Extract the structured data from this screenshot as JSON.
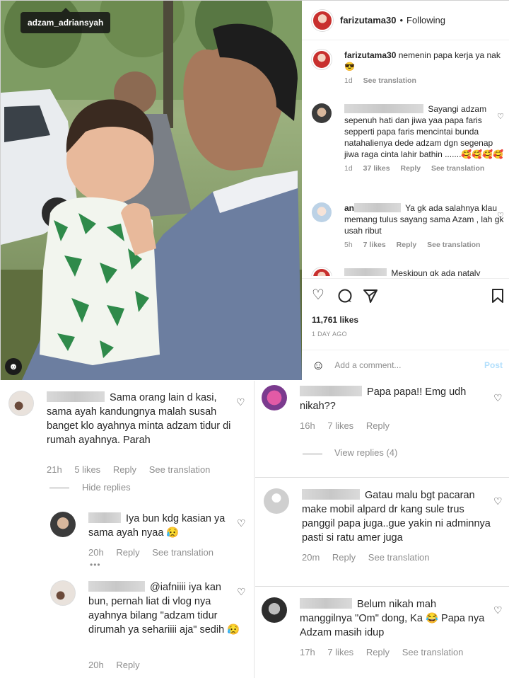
{
  "post": {
    "tag_username": "adzam_adriansyah",
    "header": {
      "username": "farizutama30",
      "separator": "•",
      "follow_status": "Following"
    },
    "caption": {
      "username": "farizutama30",
      "text": "nemenin papa kerja ya nak 😎",
      "time": "1d",
      "see_translation": "See translation"
    },
    "comments": [
      {
        "text": "Sayangi adzam sepenuh hati dan jiwa yaa papa faris sepperti papa faris mencintai bunda natahalienya dede adzam dgn segenap jiwa raga cinta lahir bathin .......🥰🥰🥰🥰",
        "time": "1d",
        "likes": "37 likes",
        "reply": "Reply",
        "see_translation": "See translation"
      },
      {
        "prefix": "an",
        "text": "Ya gk ada salahnya klau memang tulus sayang sama Azam , lah gk usah ribut",
        "time": "5h",
        "likes": "7 likes",
        "reply": "Reply",
        "see_translation": "See translation"
      },
      {
        "text": "Meskipun gk ada nataly"
      }
    ],
    "likes": "11,761 likes",
    "date": "1 DAY AGO",
    "add_comment_placeholder": "Add a comment...",
    "post_button": "Post",
    "icons": {
      "like": "heart-icon",
      "comment": "comment-icon",
      "share": "share-icon",
      "save": "bookmark-icon",
      "emoji": "emoji-icon",
      "user_tag": "user-tag-icon"
    }
  },
  "left_panel": {
    "comment1": {
      "text": "Sama orang lain d kasi, sama ayah kandungnya malah susah banget klo ayahnya minta adzam tidur di rumah ayahnya. Parah",
      "time": "21h",
      "likes": "5 likes",
      "reply": "Reply",
      "see_translation": "See translation"
    },
    "hide_replies": "Hide replies",
    "reply1": {
      "text": "Iya bun kdg kasian ya sama ayah nyaa 😥",
      "time": "20h",
      "reply": "Reply",
      "see_translation": "See translation"
    },
    "more_dots": "•••",
    "reply2": {
      "mention": "@iafniiii",
      "text": "iya kan bun, pernah liat di vlog nya ayahnya bilang \"adzam tidur dirumah ya sehariiii aja\" sedih 😥",
      "time": "20h",
      "reply": "Reply"
    }
  },
  "right_panel": {
    "comment1": {
      "text": "Papa papa!! Emg udh nikah??",
      "time": "16h",
      "likes": "7 likes",
      "reply": "Reply"
    },
    "view_replies": "View replies (4)",
    "comment2": {
      "text": "Gatau malu bgt pacaran make mobil alpard dr kang sule trus panggil papa juga..gue yakin ni adminnya pasti si ratu amer juga",
      "time": "20m",
      "reply": "Reply",
      "see_translation": "See translation"
    },
    "comment3": {
      "text": "Belum nikah mah manggilnya \"Om\" dong, Ka 😂 Papa nya Adzam masih idup",
      "time": "17h",
      "likes": "7 likes",
      "reply": "Reply",
      "see_translation": "See translation"
    }
  }
}
